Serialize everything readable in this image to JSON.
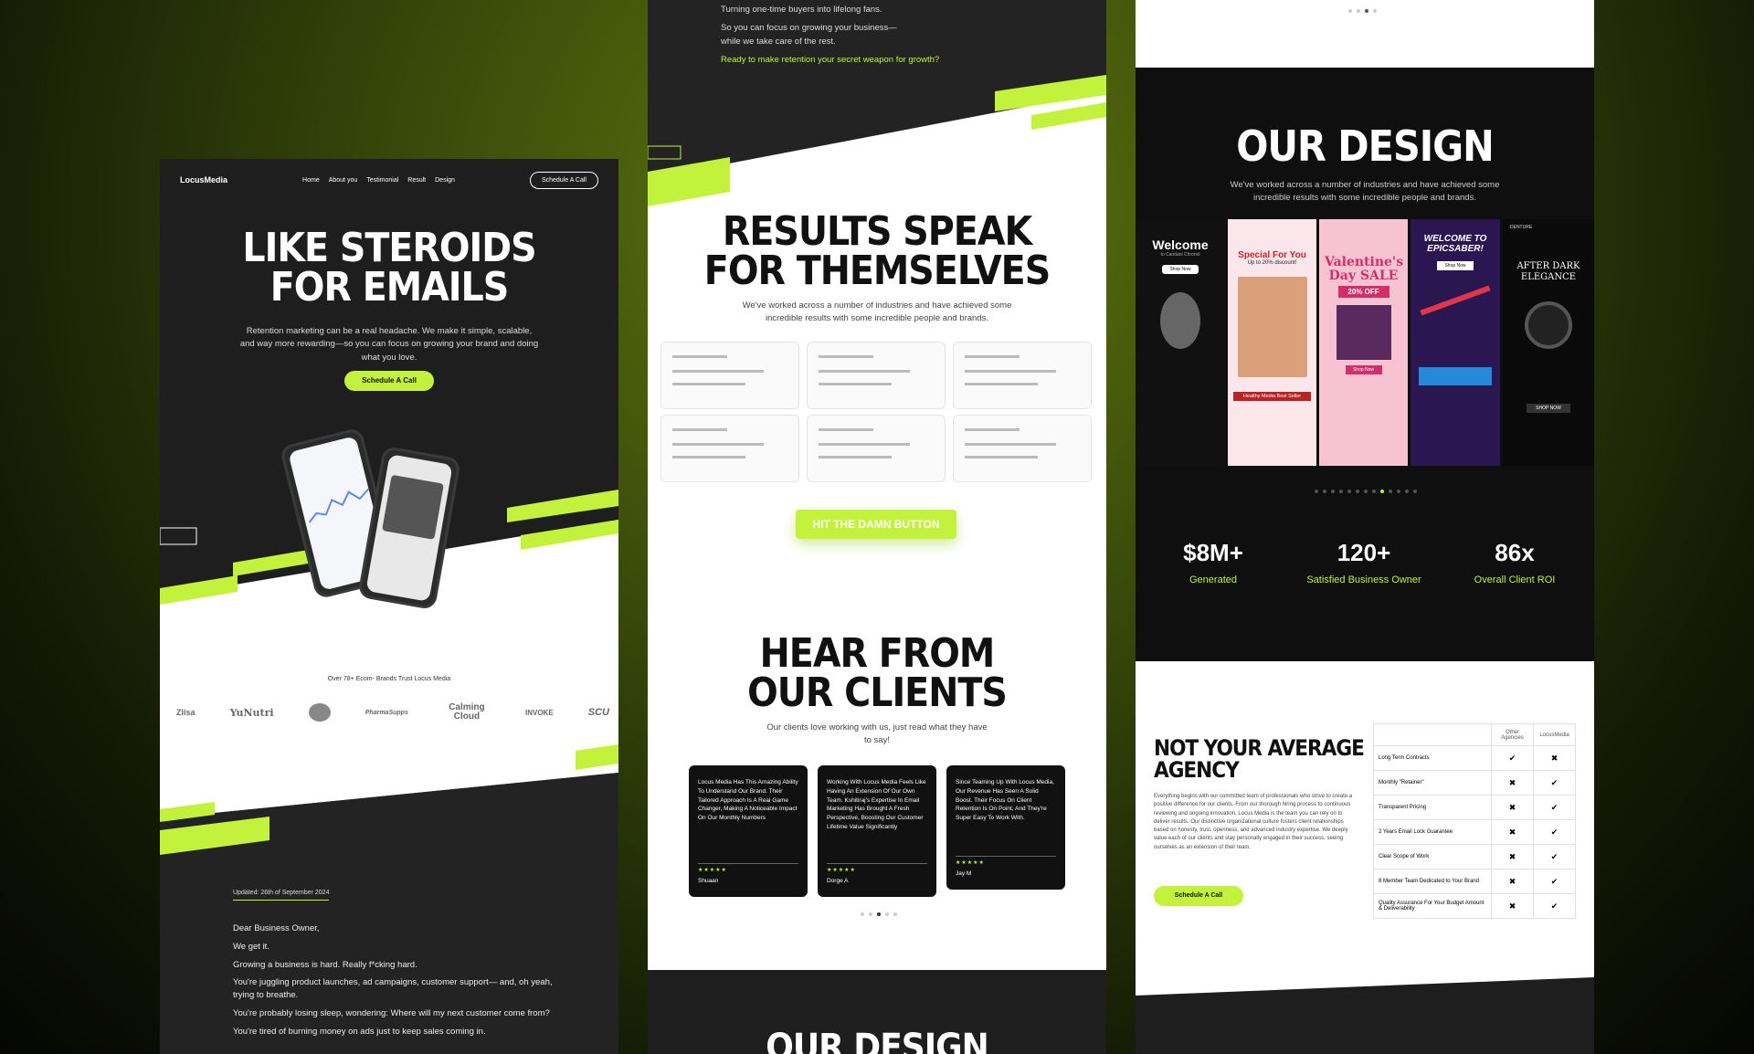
{
  "panel1": {
    "brand": "LocusMedia",
    "nav": [
      "Home",
      "About you",
      "Testimonial",
      "Result",
      "Design"
    ],
    "cta_outline": "Schedule A Call",
    "hero_title_1": "LIKE STEROIDS",
    "hero_title_2": "FOR EMAILS",
    "hero_sub": "Retention marketing can be a real headache. We make it simple, scalable, and way more rewarding—so you can focus on growing your brand and doing what you love.",
    "cta_primary": "Schedule A Call",
    "brands_heading": "Over 78+ Ecom- Brands Trust Locus Media",
    "brands": [
      "Zlisa",
      "YuNutri",
      "",
      "PharmaSupps",
      "Calming Cloud",
      "INVOKE",
      "SCU"
    ],
    "updated": "Updated: 26th of September 2024",
    "letter": [
      "Dear Business Owner,",
      "We get it.",
      "Growing a business is hard. Really f*cking hard.",
      "You're juggling product launches, ad campaigns, customer support— and, oh yeah, trying to breathe.",
      "You're probably losing sleep, wondering: Where will my next customer come from?",
      "You're tired of burning money on ads just to keep sales coming in."
    ]
  },
  "panel2": {
    "top_line_1": "Turning one-time buyers into lifelong fans.",
    "top_line_2": "So you can focus on growing your business—",
    "top_line_3": "while we take care of the rest.",
    "top_link": "Ready to make retention your secret weapon for growth?",
    "results_1": "RESULTS SPEAK",
    "results_2": "FOR THEMSELVES",
    "results_sub": "We've worked across a number of industries and have achieved some incredible results with some incredible people and brands.",
    "hit_button": "HIT THE DAMN BUTTON",
    "clients_1": "HEAR FROM",
    "clients_2": "OUR CLIENTS",
    "clients_sub": "Our clients love working with us, just read what they have to say!",
    "testimonials": [
      {
        "text": "Locus Media Has This Amazing Ability To Understand Our Brand. Their Tailored Approach Is A Real Game Changer, Making A Noticeable Impact On Our Monthly Numbers",
        "stars": "★★★★★",
        "name": "Shuaan"
      },
      {
        "text": "Working With Locus Media Feels Like Having An Extension Of Our Own Team. Kshitiraj's Expertise In Email Marketing Has Brought A Fresh Perspective, Boosting Our Customer Lifetime Value Significantly",
        "stars": "★★★★★",
        "name": "Dorge A"
      },
      {
        "text": "Since Teaming Up With Locus Media, Our Revenue Has Seen A Solid Boost. Their Focus On Client Retention Is On Point, And They're Super Easy To Work With.",
        "stars": "★★★★★",
        "name": "Jay M"
      }
    ],
    "bottom_heading": "OUR DESIGN"
  },
  "panel3": {
    "design_heading": "OUR DESIGN",
    "design_sub": "We've worked across a number of industries and have achieved some incredible results with some incredible people and brands.",
    "emails": [
      {
        "title": "Welcome",
        "sub": "to Candani Chronol",
        "btn": "Shop Now"
      },
      {
        "title": "Special For You",
        "sub": "Up to 20% discount!",
        "btn": "Healthy Media Best Seller"
      },
      {
        "title": "Valentine's Day SALE",
        "sub": "20% OFF",
        "btn": "Shop Now"
      },
      {
        "title": "WELCOME TO EPICSABER!",
        "sub": "",
        "btn": "Shop Now"
      },
      {
        "title": "AFTER DARK ELEGANCE",
        "sub": "DENTURE",
        "btn": "SHOP NOW"
      }
    ],
    "stats": [
      {
        "n": "$8M+",
        "l": "Generated"
      },
      {
        "n": "120+",
        "l": "Satisfied Business Owner"
      },
      {
        "n": "86x",
        "l": "Overall Client ROI"
      }
    ],
    "agency_1": "NOT YOUR AVERAGE",
    "agency_2": "AGENCY",
    "agency_body": "Everything begins with our committed team of professionals who strive to create a positive difference for our clients. From our thorough hiring process to continuous reviewing and ongoing innovation, Locus Media is the team you can rely on to deliver results. Our distinctive organizational culture fosters client relationships based on honesty, trust, openness, and advanced industry expertise. We deeply value each of our clients and stay personally engaged in their success, seeing ourselves as an extension of their team.",
    "agency_cta": "Schedule A Call",
    "table_cols": [
      "Other Agencies",
      "LocusMedia"
    ],
    "table_rows": [
      {
        "label": "Long Term Contracts",
        "a": "✔",
        "b": "✖"
      },
      {
        "label": "Monthly \"Retainer\"",
        "a": "✖",
        "b": "✔"
      },
      {
        "label": "Transparent Pricing",
        "a": "✖",
        "b": "✔"
      },
      {
        "label": "2 Years Email Lock Guarantee",
        "a": "✖",
        "b": "✔"
      },
      {
        "label": "Clear Scope of Work",
        "a": "✖",
        "b": "✔"
      },
      {
        "label": "8 Member Team Dedicated to Your Brand",
        "a": "✖",
        "b": "✔"
      },
      {
        "label": "Quality Assurance For Your Budget Amount & Deliverability",
        "a": "✖",
        "b": "✔"
      }
    ]
  },
  "colors": {
    "accent": "#c2f23b",
    "dark": "#1e1e1e"
  }
}
